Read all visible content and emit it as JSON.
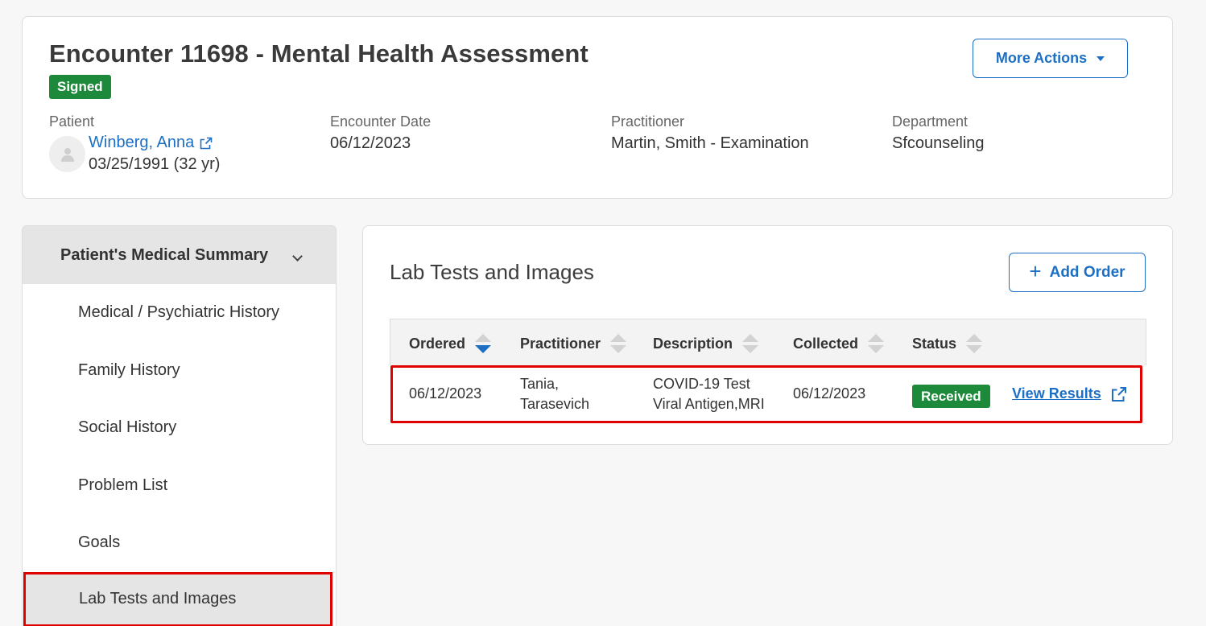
{
  "encounter": {
    "title": "Encounter 11698 - Mental Health Assessment",
    "status_badge": "Signed",
    "more_actions_label": "More Actions",
    "patient_label": "Patient",
    "patient_name": "Winberg, Anna",
    "patient_dob": "03/25/1991 (32 yr)",
    "date_label": "Encounter Date",
    "date_value": "06/12/2023",
    "practitioner_label": "Practitioner",
    "practitioner_value": "Martin, Smith - Examination",
    "department_label": "Department",
    "department_value": "Sfcounseling"
  },
  "sidebar": {
    "header": "Patient's Medical Summary",
    "items": [
      {
        "label": "Medical / Psychiatric History"
      },
      {
        "label": "Family History"
      },
      {
        "label": "Social History"
      },
      {
        "label": "Problem List"
      },
      {
        "label": "Goals"
      },
      {
        "label": "Lab Tests and Images"
      }
    ]
  },
  "main": {
    "title": "Lab Tests and Images",
    "add_order_label": "Add Order",
    "columns": [
      "Ordered",
      "Practitioner",
      "Description",
      "Collected",
      "Status"
    ],
    "rows": [
      {
        "ordered": "06/12/2023",
        "practitioner_line1": "Tania,",
        "practitioner_line2": "Tarasevich",
        "description_line1": "COVID-19 Test",
        "description_line2": "Viral Antigen,MRI",
        "collected": "06/12/2023",
        "status": "Received",
        "action": "View Results"
      }
    ]
  },
  "colors": {
    "accent": "#1d6fc4",
    "success": "#1d8a3b",
    "highlight": "#e00000"
  }
}
